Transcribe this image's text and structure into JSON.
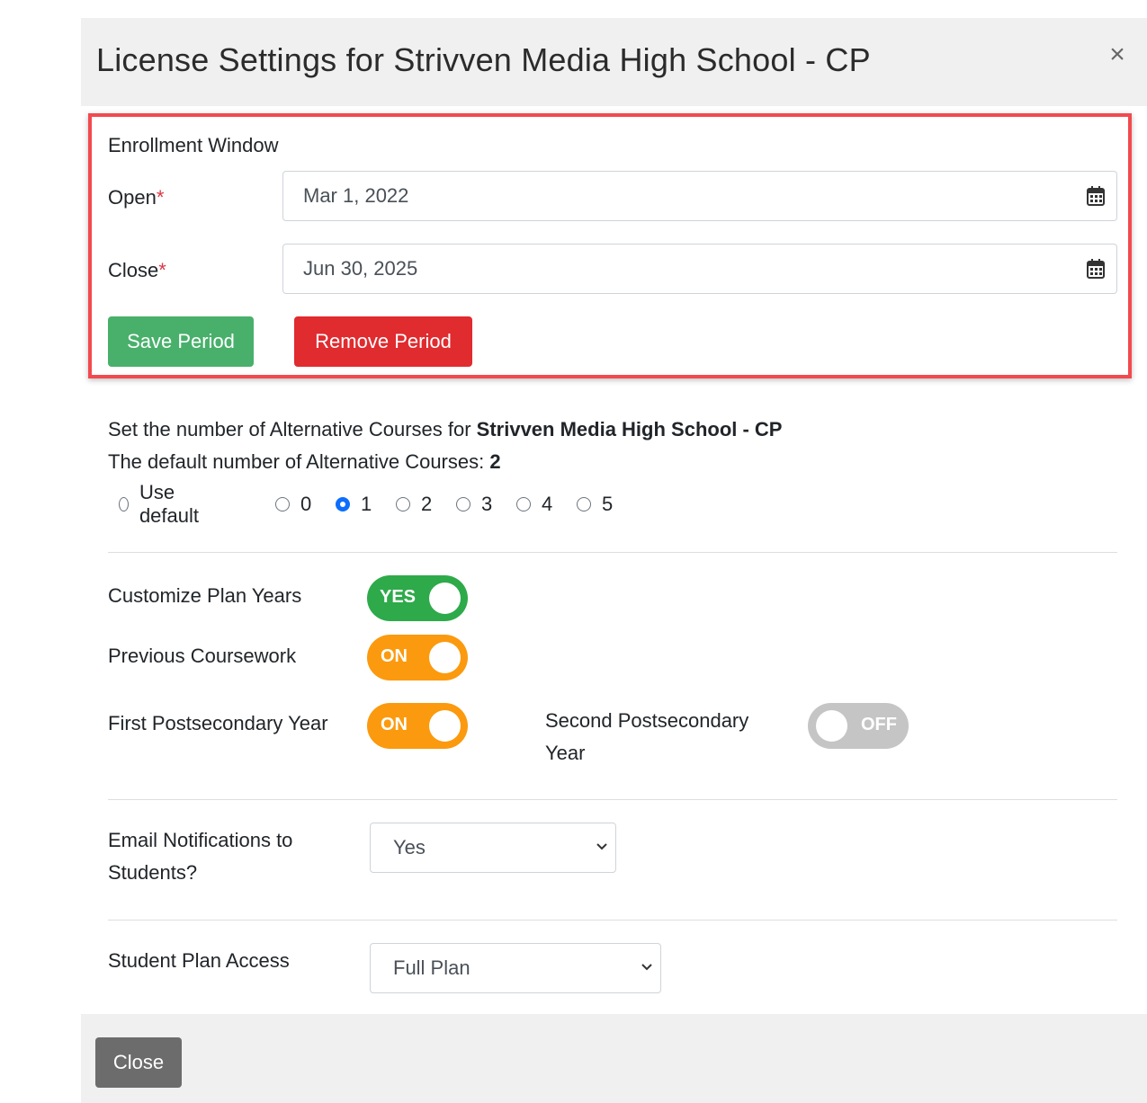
{
  "modal": {
    "title": "License Settings for Strivven Media High School - CP",
    "close_icon": "×"
  },
  "enrollment": {
    "heading": "Enrollment Window",
    "open_label": "Open",
    "close_label": "Close",
    "required_mark": "*",
    "open_value": "Mar 1, 2022",
    "close_value": "Jun 30, 2025",
    "calendar_icon": "calendar-icon",
    "save_button": "Save Period",
    "remove_button": "Remove Period"
  },
  "alt_courses": {
    "line1_prefix": "Set the number of Alternative Courses for ",
    "school_name": "Strivven Media High School - CP",
    "line2_prefix": "The default number of Alternative Courses: ",
    "default_value": "2",
    "options": [
      "Use default",
      "0",
      "1",
      "2",
      "3",
      "4",
      "5"
    ],
    "selected": "1"
  },
  "toggles": {
    "customize_plan_years": {
      "label": "Customize Plan Years",
      "state": "YES",
      "color": "#2eaa4a"
    },
    "previous_coursework": {
      "label": "Previous Coursework",
      "state": "ON",
      "color": "#fb9a0e"
    },
    "first_postsecondary": {
      "label": "First Postsecondary Year",
      "state": "ON",
      "color": "#fb9a0e"
    },
    "second_postsecondary": {
      "label_line1": "Second Postsecondary",
      "label_line2": "Year",
      "state": "OFF",
      "color": "#c5c5c5"
    }
  },
  "email_notifications": {
    "label_line1": "Email Notifications to",
    "label_line2": "Students?",
    "value": "Yes"
  },
  "student_plan_access": {
    "label": "Student Plan Access",
    "value": "Full Plan"
  },
  "footer": {
    "close_button": "Close"
  },
  "colors": {
    "highlight_border": "#f24a4f",
    "save": "#48b06b",
    "remove": "#e02b2f",
    "radio_checked": "#0d6efd"
  }
}
